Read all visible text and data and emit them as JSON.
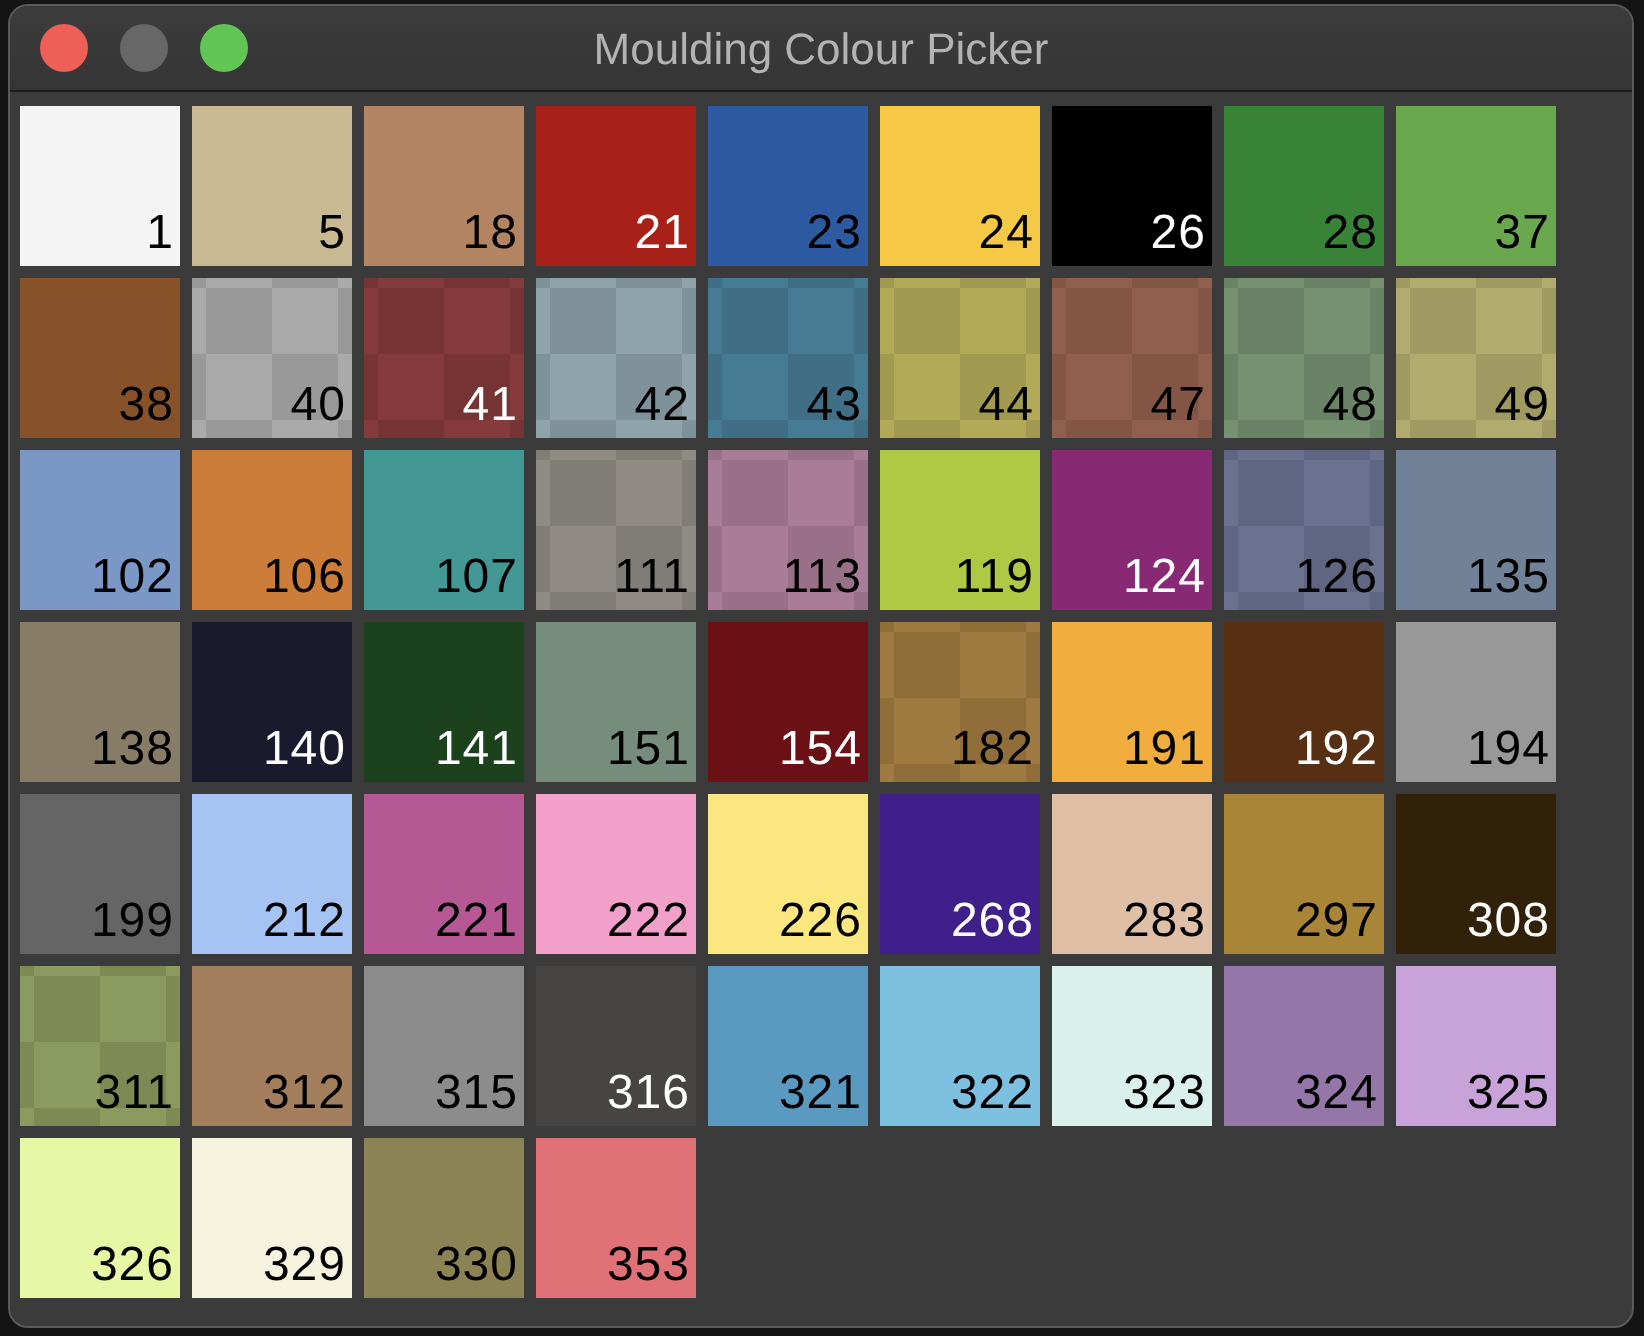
{
  "window": {
    "title": "Moulding Colour Picker",
    "controls": [
      {
        "kind": "close",
        "disabled": false
      },
      {
        "kind": "minimize",
        "disabled": true
      },
      {
        "kind": "zoom",
        "disabled": false
      }
    ]
  },
  "swatches": [
    {
      "label": "1",
      "color": "#f4f4f4",
      "kind": "solid",
      "light_text": false
    },
    {
      "label": "5",
      "color": "#c9b993",
      "kind": "solid",
      "light_text": false
    },
    {
      "label": "18",
      "color": "#b38462",
      "kind": "solid",
      "light_text": false
    },
    {
      "label": "21",
      "color": "#a72119",
      "kind": "solid",
      "light_text": true
    },
    {
      "label": "23",
      "color": "#2d5aa1",
      "kind": "solid",
      "light_text": false
    },
    {
      "label": "24",
      "color": "#f5c945",
      "kind": "solid",
      "light_text": false
    },
    {
      "label": "26",
      "color": "#000000",
      "kind": "solid",
      "light_text": true
    },
    {
      "label": "28",
      "color": "#398337",
      "kind": "solid",
      "light_text": false
    },
    {
      "label": "37",
      "color": "#6aa84f",
      "kind": "solid",
      "light_text": false
    },
    {
      "label": "38",
      "color": "#87522a",
      "kind": "solid",
      "light_text": false
    },
    {
      "label": "40",
      "color": "#aaaaaa",
      "kind": "checkered",
      "light_text": false
    },
    {
      "label": "41",
      "color": "#853a3b",
      "kind": "checkered",
      "light_text": true
    },
    {
      "label": "42",
      "color": "#8fa3aa",
      "kind": "checkered",
      "light_text": false
    },
    {
      "label": "43",
      "color": "#467b94",
      "kind": "checkered",
      "light_text": false
    },
    {
      "label": "44",
      "color": "#b3aa58",
      "kind": "checkered",
      "light_text": false
    },
    {
      "label": "47",
      "color": "#915f4d",
      "kind": "checkered",
      "light_text": false
    },
    {
      "label": "48",
      "color": "#769170",
      "kind": "checkered",
      "light_text": false
    },
    {
      "label": "49",
      "color": "#b1ac6d",
      "kind": "checkered",
      "light_text": false
    },
    {
      "label": "102",
      "color": "#7a97c6",
      "kind": "solid",
      "light_text": false
    },
    {
      "label": "106",
      "color": "#cb7d39",
      "kind": "solid",
      "light_text": false
    },
    {
      "label": "107",
      "color": "#439794",
      "kind": "solid",
      "light_text": false
    },
    {
      "label": "111",
      "color": "#8f8a83",
      "kind": "checkered",
      "light_text": false
    },
    {
      "label": "113",
      "color": "#a97d97",
      "kind": "checkered",
      "light_text": false
    },
    {
      "label": "119",
      "color": "#afc944",
      "kind": "solid",
      "light_text": false
    },
    {
      "label": "124",
      "color": "#872a73",
      "kind": "solid",
      "light_text": true
    },
    {
      "label": "126",
      "color": "#6b7290",
      "kind": "checkered",
      "light_text": false
    },
    {
      "label": "135",
      "color": "#718198",
      "kind": "solid",
      "light_text": false
    },
    {
      "label": "138",
      "color": "#877d67",
      "kind": "solid",
      "light_text": false
    },
    {
      "label": "140",
      "color": "#1a1a2e",
      "kind": "solid",
      "light_text": true
    },
    {
      "label": "141",
      "color": "#1b421d",
      "kind": "solid",
      "light_text": true
    },
    {
      "label": "151",
      "color": "#768c7d",
      "kind": "solid",
      "light_text": false
    },
    {
      "label": "154",
      "color": "#6b1015",
      "kind": "solid",
      "light_text": true
    },
    {
      "label": "182",
      "color": "#a07b41",
      "kind": "checkered",
      "light_text": false
    },
    {
      "label": "191",
      "color": "#f1ad3e",
      "kind": "solid",
      "light_text": false
    },
    {
      "label": "192",
      "color": "#572f12",
      "kind": "solid",
      "light_text": true
    },
    {
      "label": "194",
      "color": "#989898",
      "kind": "solid",
      "light_text": false
    },
    {
      "label": "199",
      "color": "#656565",
      "kind": "solid",
      "light_text": false
    },
    {
      "label": "212",
      "color": "#a5c4f4",
      "kind": "solid",
      "light_text": false
    },
    {
      "label": "221",
      "color": "#b65894",
      "kind": "solid",
      "light_text": false
    },
    {
      "label": "222",
      "color": "#f1a1c9",
      "kind": "solid",
      "light_text": false
    },
    {
      "label": "226",
      "color": "#fbe77f",
      "kind": "solid",
      "light_text": false
    },
    {
      "label": "268",
      "color": "#3f1f8a",
      "kind": "solid",
      "light_text": true
    },
    {
      "label": "283",
      "color": "#dfbfa6",
      "kind": "solid",
      "light_text": false
    },
    {
      "label": "297",
      "color": "#a98537",
      "kind": "solid",
      "light_text": false
    },
    {
      "label": "308",
      "color": "#302108",
      "kind": "solid",
      "light_text": true
    },
    {
      "label": "311",
      "color": "#8b9a5e",
      "kind": "checkered",
      "light_text": false
    },
    {
      "label": "312",
      "color": "#a27e5c",
      "kind": "solid",
      "light_text": false
    },
    {
      "label": "315",
      "color": "#8c8c8c",
      "kind": "solid",
      "light_text": false
    },
    {
      "label": "316",
      "color": "#464544",
      "kind": "solid",
      "light_text": true
    },
    {
      "label": "321",
      "color": "#5a99c0",
      "kind": "solid",
      "light_text": false
    },
    {
      "label": "322",
      "color": "#7ec0df",
      "kind": "solid",
      "light_text": false
    },
    {
      "label": "323",
      "color": "#daf0ea",
      "kind": "solid",
      "light_text": false
    },
    {
      "label": "324",
      "color": "#9477a8",
      "kind": "solid",
      "light_text": false
    },
    {
      "label": "325",
      "color": "#c7a3d9",
      "kind": "solid",
      "light_text": false
    },
    {
      "label": "326",
      "color": "#e7f7a6",
      "kind": "solid",
      "light_text": false
    },
    {
      "label": "329",
      "color": "#f5f3dd",
      "kind": "solid",
      "light_text": false
    },
    {
      "label": "330",
      "color": "#8b8354",
      "kind": "solid",
      "light_text": false
    },
    {
      "label": "353",
      "color": "#e07277",
      "kind": "solid",
      "light_text": false
    }
  ]
}
